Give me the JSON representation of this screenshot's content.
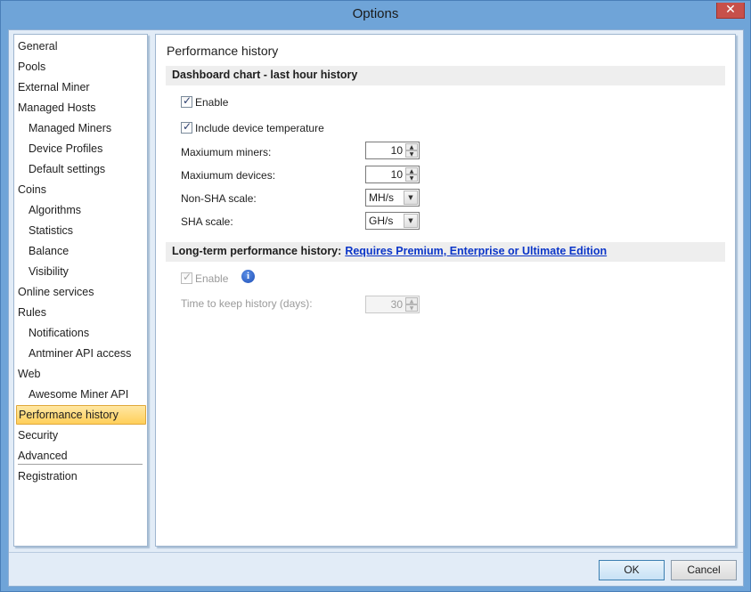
{
  "window": {
    "title": "Options",
    "close_label": "✕"
  },
  "sidebar": {
    "items": [
      {
        "label": "General"
      },
      {
        "label": "Pools"
      },
      {
        "label": "External Miner"
      },
      {
        "label": "Managed Hosts"
      },
      {
        "label": "Managed Miners"
      },
      {
        "label": "Device Profiles"
      },
      {
        "label": "Default settings"
      },
      {
        "label": "Coins"
      },
      {
        "label": "Algorithms"
      },
      {
        "label": "Statistics"
      },
      {
        "label": "Balance"
      },
      {
        "label": "Visibility"
      },
      {
        "label": "Online services"
      },
      {
        "label": "Rules"
      },
      {
        "label": "Notifications"
      },
      {
        "label": "Antminer API access"
      },
      {
        "label": "Web"
      },
      {
        "label": "Awesome Miner API"
      },
      {
        "label": "Performance history"
      },
      {
        "label": "Security"
      },
      {
        "label": "Advanced"
      },
      {
        "label": "Registration"
      }
    ],
    "selected": "Performance history"
  },
  "content": {
    "page_title": "Performance history",
    "dashboard": {
      "section_title": "Dashboard chart - last hour history",
      "enable_label": "Enable",
      "enable_checked": true,
      "temp_label": "Include device temperature",
      "temp_checked": true,
      "max_miners_label": "Maxiumum miners:",
      "max_miners_value": "10",
      "max_devices_label": "Maxiumum devices:",
      "max_devices_value": "10",
      "nonsha_label": "Non-SHA scale:",
      "nonsha_value": "MH/s",
      "sha_label": "SHA scale:",
      "sha_value": "GH/s"
    },
    "longterm": {
      "section_title": "Long-term performance history:",
      "section_link": "Requires Premium, Enterprise or Ultimate Edition",
      "enable_label": "Enable",
      "enable_checked": true,
      "keep_label": "Time to keep history (days):",
      "keep_value": "30",
      "info_icon": "info-icon"
    }
  },
  "footer": {
    "ok_label": "OK",
    "cancel_label": "Cancel"
  },
  "colors": {
    "selected_bg": "#ffcf5a",
    "link": "#0b35c8",
    "frame": "#6fa4d8"
  }
}
